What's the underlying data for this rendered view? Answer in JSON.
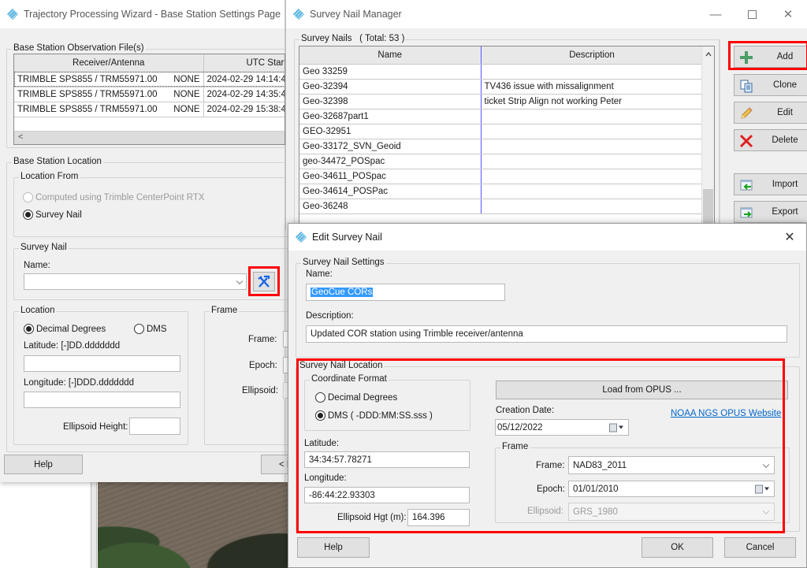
{
  "wizard": {
    "title": "Trajectory Processing Wizard - Base Station Settings Page",
    "obs_group_label": "Base Station Observation File(s)",
    "columns": [
      "Receiver/Antenna",
      "UTC Start"
    ],
    "rows": [
      {
        "receiver": "TRIMBLE SPS855 / TRM55971.00",
        "radome": "NONE",
        "utc_start": "2024-02-29 14:14:4"
      },
      {
        "receiver": "TRIMBLE SPS855 / TRM55971.00",
        "radome": "NONE",
        "utc_start": "2024-02-29 14:35:4"
      },
      {
        "receiver": "TRIMBLE SPS855 / TRM55971.00",
        "radome": "NONE",
        "utc_start": "2024-02-29 15:38:4"
      }
    ],
    "scroll_left_glyph": "<",
    "location_group_label": "Base Station Location",
    "location_from_label": "Location From",
    "radio_computed": "Computed using Trimble CenterPoint RTX",
    "radio_survey_nail": "Survey Nail",
    "survey_nail_group_label": "Survey Nail",
    "name_label": "Name:",
    "name_value": "",
    "location_sub_label": "Location",
    "radio_decimal": "Decimal Degrees",
    "radio_dms": "DMS",
    "latitude_label": "Latitude:  [-]DD.ddddddd",
    "latitude_value": "",
    "longitude_label": "Longitude:  [-]DDD.ddddddd",
    "longitude_value": "",
    "ellipsoid_height_label": "Ellipsoid Height:",
    "ellipsoid_height_value": "",
    "frame_group_label": "Frame",
    "frame_label": "Frame:",
    "epoch_label": "Epoch:",
    "ellipsoid_label": "Ellipsoid:",
    "help_button": "Help",
    "back_button": "< B"
  },
  "manager": {
    "title": "Survey Nail Manager",
    "group_label": "Survey Nails",
    "total_label": "( Total: 53 )",
    "columns": [
      "Name",
      "Description"
    ],
    "rows": [
      {
        "name": "Geo 33259",
        "description": ""
      },
      {
        "name": "Geo-32394",
        "description": "TV436 issue with missalignment"
      },
      {
        "name": "Geo-32398",
        "description": "ticket Strip Align not working Peter"
      },
      {
        "name": "Geo-32687part1",
        "description": ""
      },
      {
        "name": "GEO-32951",
        "description": ""
      },
      {
        "name": "Geo-33172_SVN_Geoid",
        "description": ""
      },
      {
        "name": "geo-34472_POSpac",
        "description": ""
      },
      {
        "name": "Geo-34611_POSpac",
        "description": ""
      },
      {
        "name": "Geo-34614_POSPac",
        "description": ""
      },
      {
        "name": "Geo-36248",
        "description": ""
      }
    ],
    "buttons": {
      "add": "Add",
      "clone": "Clone",
      "edit": "Edit",
      "delete": "Delete",
      "import": "Import",
      "export": "Export"
    },
    "icons": {
      "add": "plus-icon",
      "clone": "copy-icon",
      "edit": "pencil-icon",
      "delete": "x-delete-icon",
      "import": "import-icon",
      "export": "export-icon"
    }
  },
  "edit_dialog": {
    "title": "Edit Survey Nail",
    "settings_group_label": "Survey Nail Settings",
    "name_label": "Name:",
    "name_value": "GeoCue CORs",
    "description_label": "Description:",
    "description_value": "Updated COR station using Trimble receiver/antenna",
    "location_group_label": "Survey Nail Location",
    "coord_format_label": "Coordinate Format",
    "radio_decimal": "Decimal Degrees",
    "radio_dms": "DMS  ( -DDD:MM:SS.sss )",
    "latitude_label": "Latitude:",
    "latitude_value": "34:34:57.78271",
    "longitude_label": "Longitude:",
    "longitude_value": "-86:44:22.93303",
    "ellipsoid_hgt_label": "Ellipsoid Hgt (m):",
    "ellipsoid_hgt_value": "164.396",
    "load_opus_button": "Load from OPUS ...",
    "creation_date_label": "Creation Date:",
    "creation_date_value": "05/12/2022",
    "opus_link": "NOAA NGS OPUS Website",
    "frame_group_label": "Frame",
    "frame_label": "Frame:",
    "frame_value": "NAD83_2011",
    "epoch_label": "Epoch:",
    "epoch_value": "01/01/2010",
    "ellipsoid_label": "Ellipsoid:",
    "ellipsoid_value": "GRS_1980",
    "help_button": "Help",
    "ok_button": "OK",
    "cancel_button": "Cancel"
  },
  "colors": {
    "highlight_red": "#ff0000",
    "selection_blue": "#3399ff",
    "link_blue": "#0066cc",
    "column_divider": "#5555ff"
  }
}
